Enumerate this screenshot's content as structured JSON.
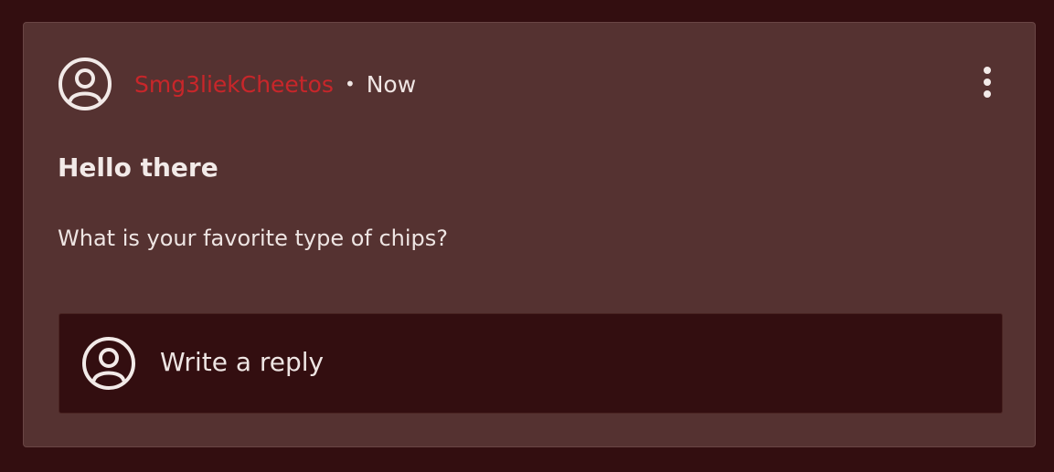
{
  "post": {
    "username": "Smg3liekCheetos",
    "separator": "•",
    "time": "Now",
    "title": "Hello there",
    "body": "What is your favorite type of chips?",
    "avatar_icon": "user-circle-icon",
    "menu_icon": "more-vertical-icon"
  },
  "reply": {
    "placeholder": "Write a reply",
    "avatar_icon": "user-circle-icon"
  },
  "colors": {
    "background": "#330e10",
    "card": "#553231",
    "username": "#c8262a",
    "text": "#f2eae8"
  }
}
